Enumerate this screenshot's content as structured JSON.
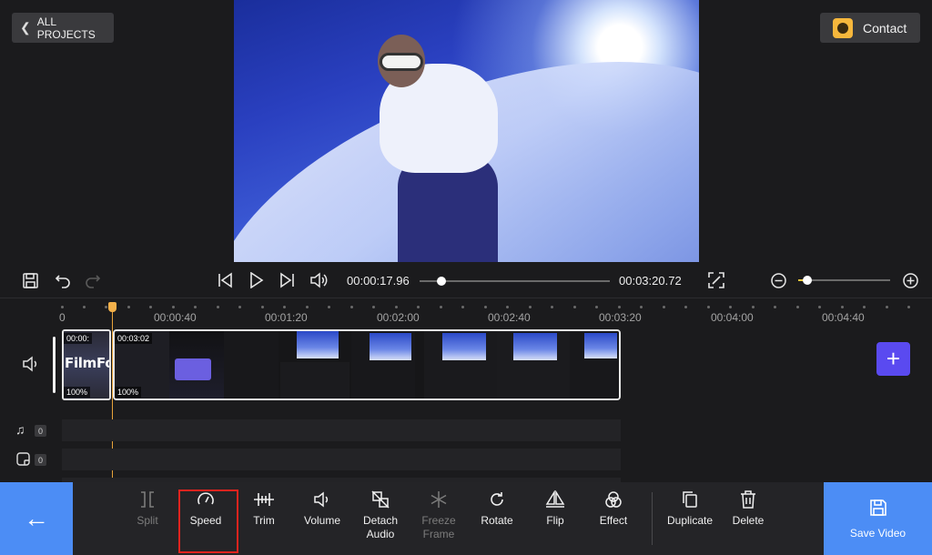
{
  "header": {
    "all_projects_label": "ALL PROJECTS",
    "contact_label": "Contact"
  },
  "player": {
    "current_time": "00:00:17.96",
    "total_time": "00:03:20.72",
    "progress_fraction": 0.09,
    "zoom_fraction": 0.08
  },
  "ruler": {
    "labels": [
      "0",
      "00:00:40",
      "00:01:20",
      "00:02:00",
      "00:02:40",
      "00:03:20",
      "00:04:00",
      "00:04:40"
    ]
  },
  "timeline": {
    "clip1": {
      "duration": "00:00:",
      "volume": "100%",
      "title": "FilmForth"
    },
    "clip2": {
      "duration": "00:03:02",
      "volume": "100%"
    },
    "music_count": "0",
    "sticker_count": "0"
  },
  "toolbar": {
    "split": "Split",
    "speed": "Speed",
    "trim": "Trim",
    "volume": "Volume",
    "detach_audio": "Detach Audio",
    "freeze_frame": "Freeze Frame",
    "rotate": "Rotate",
    "flip": "Flip",
    "effect": "Effect",
    "duplicate": "Duplicate",
    "delete": "Delete",
    "save_video": "Save Video"
  },
  "colors": {
    "accent_blue": "#4c8df5",
    "add_purple": "#5a4af0",
    "playhead": "#e7a33b",
    "highlight_red": "#e0231e"
  }
}
